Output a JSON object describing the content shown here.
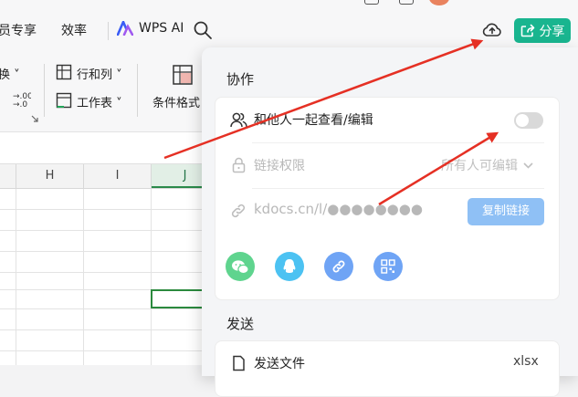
{
  "topbar": {
    "menu_member": "员专享",
    "menu_efficiency": "效率",
    "wps_ai": "WPS AI",
    "share_label": "分享"
  },
  "ribbon": {
    "convert_label": "换",
    "rows_cols_label": "行和列",
    "worksheet_label": "工作表",
    "cond_format_label": "条件格式"
  },
  "sheet": {
    "columns": [
      "H",
      "I",
      "J"
    ],
    "active_column": "J"
  },
  "share_panel": {
    "collab_title": "协作",
    "collab_toggle_label": "和他人一起查看/编辑",
    "collab_enabled": false,
    "link_perm_label": "链接权限",
    "link_perm_value": "所有人可编辑",
    "link_url": "kdocs.cn/l/●●●●●●●●",
    "copy_link_label": "复制链接",
    "share_targets": [
      "wechat-icon",
      "qq-icon",
      "link-icon",
      "qrcode-icon"
    ],
    "send_title": "发送",
    "send_file_label": "发送文件",
    "send_file_ext": "xlsx"
  },
  "colors": {
    "accent_green": "#19b58f",
    "arrow_red": "#e53024",
    "copy_button": "#8fc0f5"
  }
}
